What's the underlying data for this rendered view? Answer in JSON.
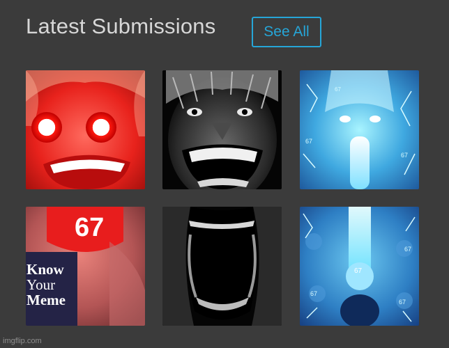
{
  "header": {
    "title": "Latest Submissions",
    "see_all_label": "See All"
  },
  "submissions": [
    {
      "caption": "",
      "style": "red-glowing-eyes"
    },
    {
      "caption": "",
      "style": "grayscale-wide-grin"
    },
    {
      "caption": "67",
      "style": "blue-glowing-scream"
    },
    {
      "caption": "67",
      "style": "red-tongue-67"
    },
    {
      "caption": "",
      "style": "dark-open-mouth"
    },
    {
      "caption": "67",
      "style": "blue-beam-67"
    }
  ],
  "badge": {
    "line1": "Know",
    "line2": "Your",
    "line3": "Meme"
  },
  "watermark": "imgflip.com",
  "colors": {
    "background": "#3b3b3b",
    "accent": "#26a6d8",
    "badge_bg": "#242346"
  }
}
